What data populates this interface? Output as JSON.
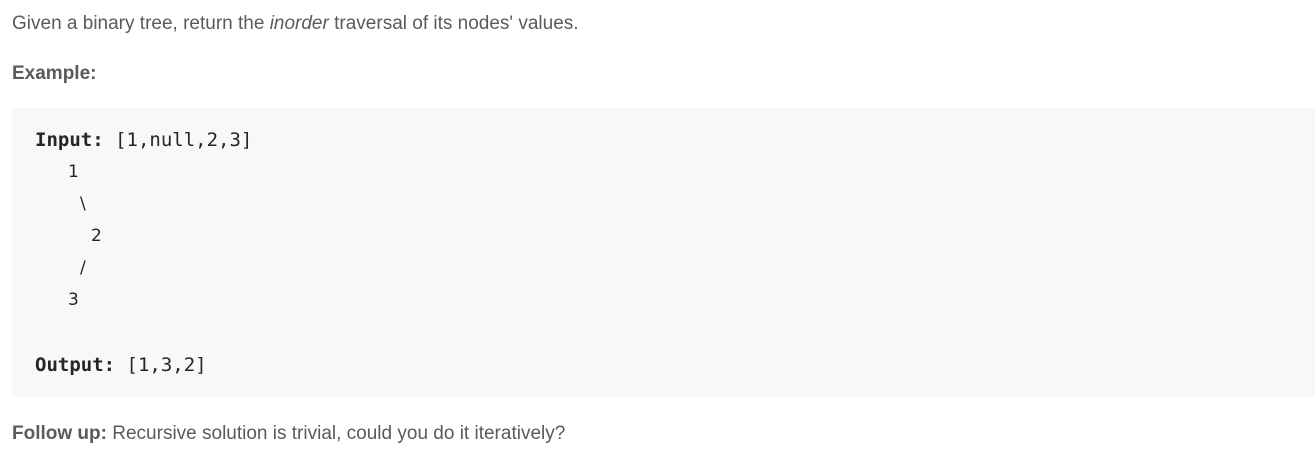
{
  "description": {
    "before": "Given a binary tree, return the ",
    "emphasis": "inorder",
    "after": " traversal of its nodes' values."
  },
  "example_heading": "Example:",
  "code": {
    "input_label": "Input:",
    "input_value": " [1,null,2,3]",
    "tree": {
      "node_1": "1",
      "edge_right": "\\",
      "node_2": "2",
      "edge_left": "/",
      "node_3": "3"
    },
    "output_label": "Output:",
    "output_value": " [1,3,2]"
  },
  "follow_up": {
    "label": "Follow up:",
    "text": " Recursive solution is trivial, could you do it iteratively?"
  }
}
